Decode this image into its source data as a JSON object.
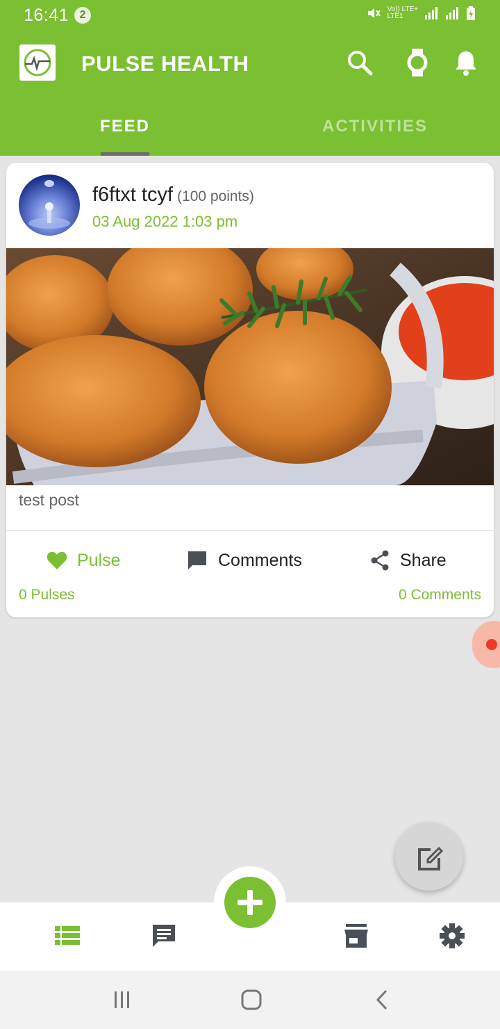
{
  "status_bar": {
    "time": "16:41",
    "notification_count": "2",
    "network_top": "Vo)) LTE+",
    "network_bottom": "LTE1"
  },
  "app_bar": {
    "title": "PULSE HEALTH",
    "icons": [
      "search-icon",
      "watch-icon",
      "bell-icon"
    ]
  },
  "tabs": [
    {
      "label": "FEED",
      "active": true
    },
    {
      "label": "ACTIVITIES",
      "active": false
    }
  ],
  "post": {
    "author_name": "f6ftxt tcyf",
    "author_points": "(100 points)",
    "date": "03 Aug 2022 1:03 pm",
    "text": "test post",
    "actions": {
      "pulse_label": "Pulse",
      "comments_label": "Comments",
      "share_label": "Share"
    },
    "pulses_count": "0 Pulses",
    "comments_count": "0 Comments"
  },
  "bottom_nav": {
    "items": [
      "feed-list-icon",
      "chat-icon",
      "add-icon",
      "store-icon",
      "settings-icon"
    ]
  },
  "colors": {
    "brand_green": "#7bbf32",
    "inactive_tab": "#bfe19a",
    "background": "#e5e5e5"
  }
}
